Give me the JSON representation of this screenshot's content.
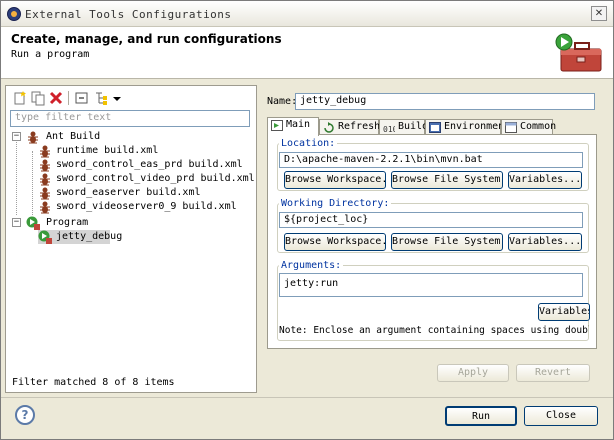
{
  "window": {
    "title": "External Tools Configurations",
    "close": "✕"
  },
  "banner": {
    "title": "Create, manage, and run configurations",
    "subtitle": "Run a program"
  },
  "left": {
    "filter_placeholder": "type filter text",
    "tree": {
      "ant_build": {
        "label": "Ant Build",
        "items": [
          "runtime build.xml",
          "sword_control_eas_prd build.xml",
          "sword_control_video_prd build.xml",
          "sword_easerver build.xml",
          "sword_videoserver0_9 build.xml"
        ]
      },
      "program": {
        "label": "Program",
        "items": [
          "jetty_debug"
        ]
      }
    },
    "status": "Filter matched 8 of 8 items"
  },
  "right": {
    "name_label": "Name:",
    "name_value": "jetty_debug",
    "tabs": [
      "Main",
      "Refresh",
      "Build",
      "Environment",
      "Common"
    ],
    "location": {
      "label": "Location:",
      "value": "D:\\apache-maven-2.2.1\\bin\\mvn.bat",
      "buttons": [
        "Browse Workspace...",
        "Browse File System...",
        "Variables..."
      ]
    },
    "working_dir": {
      "label": "Working Directory:",
      "value": "${project_loc}",
      "buttons": [
        "Browse Workspace...",
        "Browse File System...",
        "Variables..."
      ]
    },
    "arguments": {
      "label": "Arguments:",
      "value": "jetty:run",
      "button": "Variables...",
      "note": "Note: Enclose an argument containing spaces using double-quotes (\")."
    },
    "apply": "Apply",
    "revert": "Revert"
  },
  "footer": {
    "help": "?",
    "run": "Run",
    "close": "Close"
  }
}
